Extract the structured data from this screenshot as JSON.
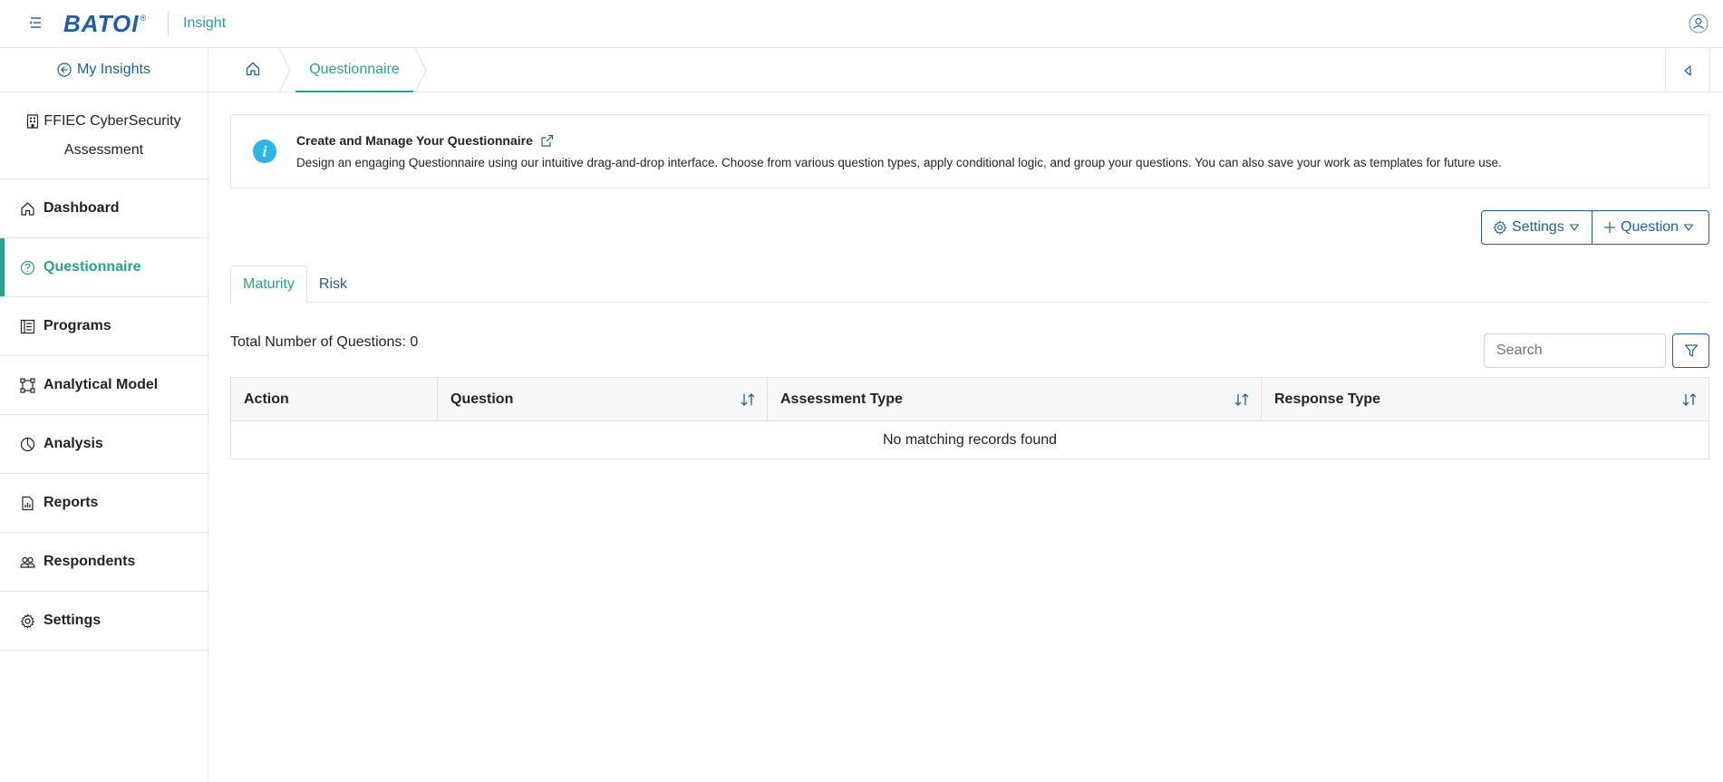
{
  "header": {
    "logo_text": "BATOI",
    "logo_reg": "®",
    "app_name": "Insight"
  },
  "sidebar": {
    "back_label": "My Insights",
    "project_line1": "FFIEC CyberSecurity",
    "project_line2": "Assessment",
    "items": [
      {
        "label": "Dashboard",
        "icon": "home-icon"
      },
      {
        "label": "Questionnaire",
        "icon": "question-circle-icon",
        "active": true
      },
      {
        "label": "Programs",
        "icon": "list-icon"
      },
      {
        "label": "Analytical Model",
        "icon": "bounding-box-icon"
      },
      {
        "label": "Analysis",
        "icon": "pie-chart-icon"
      },
      {
        "label": "Reports",
        "icon": "report-icon"
      },
      {
        "label": "Respondents",
        "icon": "people-icon"
      },
      {
        "label": "Settings",
        "icon": "gear-icon"
      }
    ]
  },
  "breadcrumb": {
    "current": "Questionnaire"
  },
  "info": {
    "title": "Create and Manage Your Questionnaire",
    "description": "Design an engaging Questionnaire using our intuitive drag-and-drop interface. Choose from various question types, apply conditional logic, and group your questions. You can also save your work as templates for future use."
  },
  "toolbar": {
    "settings_label": "Settings",
    "question_label": "Question"
  },
  "tabs": [
    {
      "label": "Maturity",
      "active": true
    },
    {
      "label": "Risk",
      "active": false
    }
  ],
  "list": {
    "total_label": "Total Number of Questions: 0",
    "search_placeholder": "Search"
  },
  "table": {
    "columns": [
      "Action",
      "Question",
      "Assessment Type",
      "Response Type"
    ],
    "empty_message": "No matching records found"
  },
  "colors": {
    "accent": "#2aa38a",
    "primary": "#1f5fa8",
    "info": "#29b6e8"
  }
}
